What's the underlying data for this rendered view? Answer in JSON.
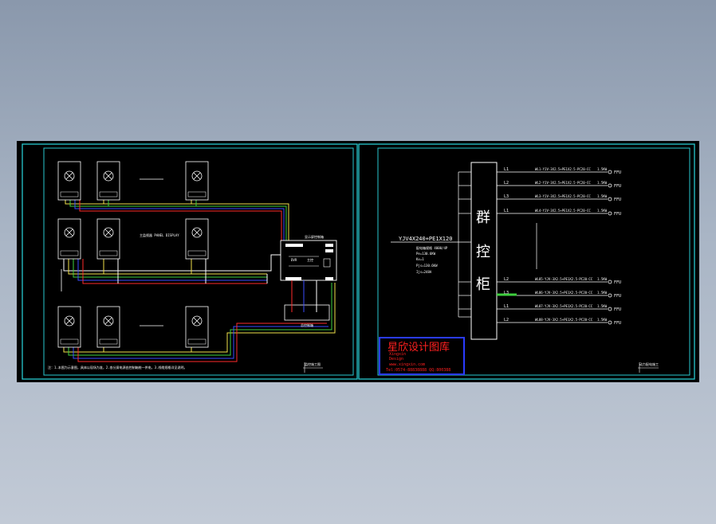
{
  "colors": {
    "frame": "#27c9cf",
    "wire_red": "#ff2a2a",
    "wire_blue": "#3a4cff",
    "wire_yellow": "#f0e04a",
    "wire_green": "#3ecf3e",
    "wire_white": "#ffffff",
    "watermark_red": "#ff2020",
    "watermark_border": "#2a3bff"
  },
  "left_sheet": {
    "panel_title": "显示屏控制箱",
    "panel_labels": [
      "DVR",
      "主控"
    ],
    "bottom_box_label": "总控制箱",
    "note": "注：1.本图为示意图，具体以现场为准，2.各分屏电源由控制箱统一供电，3.线缆规格详见说明。",
    "mid_caption": "主监视器 PANEL DISPLAY",
    "title_block": "监控施工图"
  },
  "right_sheet": {
    "cabinet_chars": [
      "群",
      "控",
      "柜"
    ],
    "feeder": "YJV4X240+PE1X120",
    "specs": [
      "配电箱规格 4000/4P",
      "Pe=130.6KW",
      "Kx=1",
      "Pjs=130.6KW",
      "Ijs=248A"
    ],
    "circuits": [
      {
        "phase": "L1",
        "cable": "WL1-YJV-3X2.5+PE1X2.5-PC20-CC",
        "power": "1.5KW",
        "load": "FFU"
      },
      {
        "phase": "L2",
        "cable": "WL2-YJV-3X2.5+PE1X2.5-PC20-CC",
        "power": "1.5KW",
        "load": "FFU"
      },
      {
        "phase": "L3",
        "cable": "WL3-YJV-3X2.5+PE1X2.5-PC20-CC",
        "power": "1.5KW",
        "load": "FFU"
      },
      {
        "phase": "L1",
        "cable": "WL4-YJV-3X2.5+PE1X2.5-PC20-CC",
        "power": "1.5KW",
        "load": "FFU"
      },
      {
        "phase": "L2",
        "cable": "WL85-YJV-3X2.5+PE1X2.5-PC20-CC",
        "power": "1.5KW",
        "load": "FFU"
      },
      {
        "phase": "L3",
        "cable": "WL86-YJV-3X2.5+PE1X2.5-PC20-CC",
        "power": "1.5KW",
        "load": "FFU"
      },
      {
        "phase": "L1",
        "cable": "WL87-YJV-3X2.5+PE1X2.5-PC20-CC",
        "power": "1.5KW",
        "load": "FFU"
      },
      {
        "phase": "L2",
        "cable": "WL88-YJV-3X2.5+PE1X2.5-PC20-CC",
        "power": "1.5KW",
        "load": "FFU"
      }
    ],
    "title_block": "动力配电施工"
  },
  "watermark": {
    "title": "星欣设计图库",
    "line1": "Xingxin",
    "line2": "Design",
    "url": "www.xingxin.com",
    "tel": "Tel:0574-88838888 QQ:800388"
  }
}
